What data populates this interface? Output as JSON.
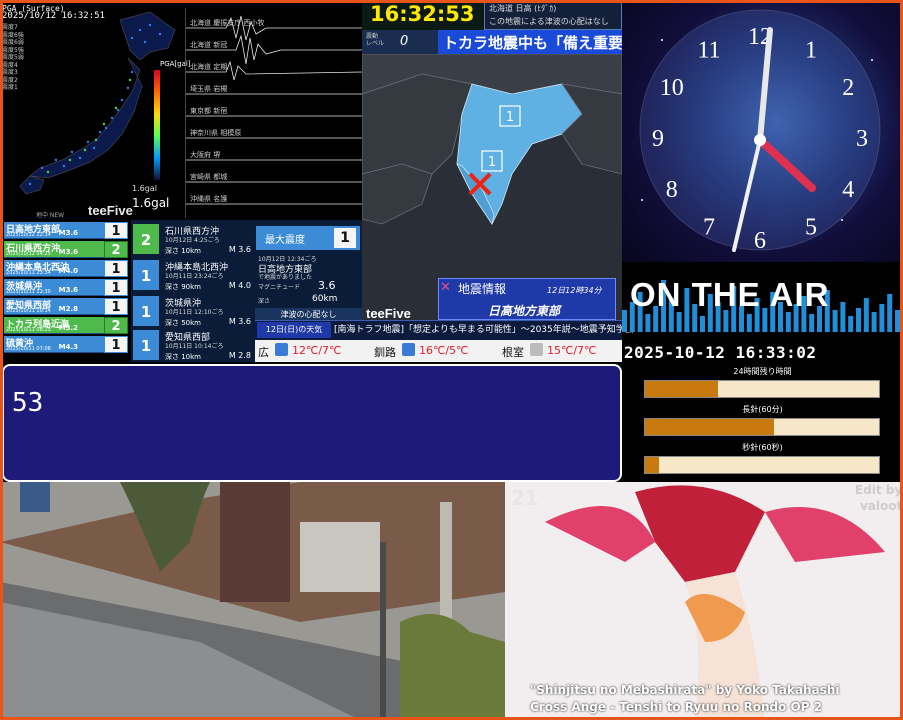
{
  "seismic": {
    "header": "PGA (Surface)",
    "timestamp": "2025/10/12 16:32:51",
    "legend": [
      "震度7",
      "震度6強",
      "震度6弱",
      "震度5強",
      "震度5弱",
      "震度4",
      "震度3",
      "震度2",
      "震度1"
    ],
    "pga_label": "PGA[gal]",
    "gal_small": "1.6gal",
    "gal_big": "1.6gal",
    "brand": "teeFive",
    "brand_label": "地中 NEW",
    "wave_labels": [
      "北海道 慶振支庁 西小牧",
      "北海道 新冠",
      "北海道 定期",
      "埼玉県 岩槻",
      "東京都 新宿",
      "神奈川県 相模原",
      "大阪府 堺",
      "宮崎県 都城",
      "沖縄県 名護"
    ]
  },
  "quake_list": [
    {
      "name": "日高地方東部",
      "date": "2025/10/12 12:34",
      "mag": "M3.6",
      "intensity": "1",
      "green": false
    },
    {
      "name": "石川県西方沖",
      "date": "2025/10/12 04:25",
      "mag": "M3.6",
      "intensity": "2",
      "green": true
    },
    {
      "name": "沖縄本島北西沖",
      "date": "2025/10/11 23:34",
      "mag": "M4.0",
      "intensity": "1",
      "green": false
    },
    {
      "name": "茨城県沖",
      "date": "2025/10/11 12:30",
      "mag": "M3.6",
      "intensity": "1",
      "green": false
    },
    {
      "name": "愛知県西部",
      "date": "2025/10/11 10:14",
      "mag": "M2.8",
      "intensity": "1",
      "green": false
    },
    {
      "name": "トカラ列島近海",
      "date": "2025/10/11 08:23",
      "mag": "M3.2",
      "intensity": "2",
      "green": true
    },
    {
      "name": "硫黄沖",
      "date": "2025/10/11 07:06",
      "mag": "M4.3",
      "intensity": "1",
      "green": false
    }
  ],
  "quake_detail": [
    {
      "intensity": "2",
      "name": "石川県西方沖",
      "date": "10月12日 4:25ごろ",
      "depth": "深さ 10km",
      "mag": "M 3.6",
      "green": true
    },
    {
      "intensity": "1",
      "name": "沖縄本島北西沖",
      "date": "10月11日 23:24ごろ",
      "depth": "深さ 90km",
      "mag": "M 4.0",
      "green": false
    },
    {
      "intensity": "1",
      "name": "茨城県沖",
      "date": "10月11日 12:10ごろ",
      "depth": "深さ 50km",
      "mag": "M 3.6",
      "green": false
    },
    {
      "intensity": "1",
      "name": "愛知県西部",
      "date": "10月11日 10:14ごろ",
      "depth": "深さ 10km",
      "mag": "M 2.8",
      "green": false
    }
  ],
  "max_panel": {
    "title": "最大震度",
    "value": "1",
    "date": "10月12日 12:34ごろ",
    "name": "日高地方東部",
    "sub": "で地震がありました",
    "mag_label": "マグニチュード",
    "mag": "3.6",
    "depth_label": "深さ",
    "depth": "60km",
    "tsunami": "津波の心配なし"
  },
  "top": {
    "time": "16:32:53",
    "note1": "北海道 日高 (ﾋﾀﾞｶ)",
    "note2": "この地震による津波の心配はなし",
    "shindo_label1": "震動",
    "shindo_label2": "レベル",
    "shindo_value": "0",
    "alert": "トカラ地震中も「備え重要」"
  },
  "map": {
    "brand": "teeFive",
    "info_title": "地震情報",
    "info_time": "12日12時34分",
    "info_region": "日高地方東部",
    "marker_labels": [
      "1",
      "1"
    ]
  },
  "ticker": {
    "date": "12日(日)の天気",
    "text": "[南海トラフ地震]「想定よりも早まる可能性」～2035年説～地震予知学会"
  },
  "weather": [
    {
      "city": "広",
      "temp": "12℃/7℃",
      "icon_color": "#3a7bd5"
    },
    {
      "city": "釧路",
      "temp": "16℃/5℃",
      "icon_color": "#3a7bd5"
    },
    {
      "city": "根室",
      "temp": "15℃/7℃",
      "icon_color": "#bbbbbb"
    }
  ],
  "message": {
    "text": "53"
  },
  "onair": {
    "label": "ON THE AIR",
    "datetime": "2025-10-12 16:33:02",
    "bars": [
      {
        "label": "24時間残り時間",
        "fraction": 0.31
      },
      {
        "label": "長針(60分)",
        "fraction": 0.55
      },
      {
        "label": "秒針(60秒)",
        "fraction": 0.06
      }
    ]
  },
  "clock_numbers": [
    "12",
    "1",
    "2",
    "3",
    "4",
    "5",
    "6",
    "7",
    "8",
    "9",
    "10",
    "11"
  ],
  "anime": {
    "number": "21",
    "edit1": "Edit by",
    "edit2": "valoot",
    "caption1": "\"Shinjitsu no Mebashirata\" by Yoko Takahashi",
    "caption2": "Cross Ange - Tenshi to Ryuu no Rondo OP 2"
  },
  "colors": {
    "frame": "#e8541a",
    "quake_blue": "#3c8bd6",
    "quake_green": "#4dba4b",
    "alert_blue": "#1a4ad8",
    "clock_yellow": "#ffe800",
    "bar_fill": "#c97a0e"
  }
}
